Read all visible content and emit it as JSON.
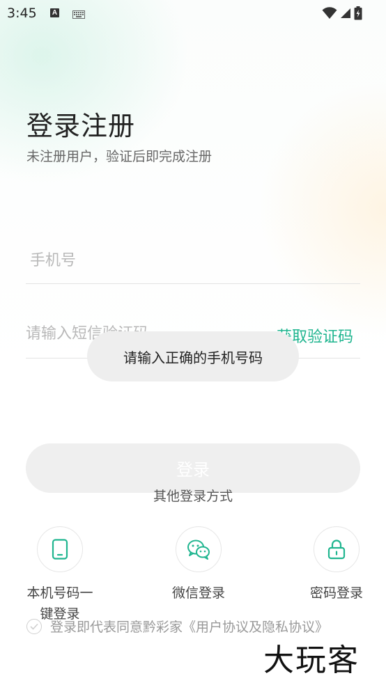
{
  "status_bar": {
    "time": "3:45",
    "badge_letter": "A"
  },
  "header": {
    "title": "登录注册",
    "subtitle": "未注册用户，验证后即完成注册"
  },
  "form": {
    "phone_placeholder": "手机号",
    "code_placeholder": "请输入短信验证码",
    "get_code_label": "获取验证码",
    "login_label": "登录"
  },
  "toast": {
    "message": "请输入正确的手机号码"
  },
  "other_login": {
    "title": "其他登录方式",
    "methods": [
      {
        "label": "本机号码一键登录",
        "icon": "phone-icon"
      },
      {
        "label": "微信登录",
        "icon": "wechat-icon"
      },
      {
        "label": "密码登录",
        "icon": "lock-icon"
      }
    ]
  },
  "agreement": {
    "text": "登录即代表同意黔彩家《用户协议及隐私协议》",
    "checked": false
  },
  "watermark": {
    "text": "大玩客"
  },
  "colors": {
    "accent": "#1fb58f",
    "button_disabled": "#efefef",
    "toast_bg": "#eeeeee"
  }
}
